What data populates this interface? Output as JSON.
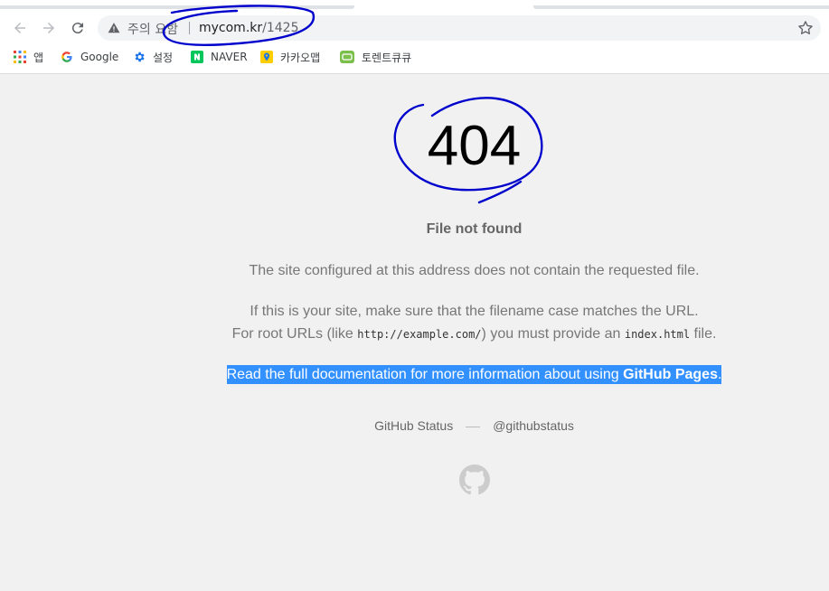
{
  "browser": {
    "back_icon": "arrow-left-icon",
    "forward_icon": "arrow-right-icon",
    "reload_icon": "reload-icon",
    "security_label": "주의 요함",
    "url_domain": "mycom.kr",
    "url_path": "/1425",
    "bookmarks": [
      {
        "label": "앱",
        "icon": "apps-grid-icon"
      },
      {
        "label": "Google",
        "icon": "google-g-icon"
      },
      {
        "label": "설정",
        "icon": "gear-icon"
      },
      {
        "label": "NAVER",
        "icon": "naver-n-icon"
      },
      {
        "label": "카카오맵",
        "icon": "map-pin-icon"
      },
      {
        "label": "토렌트큐큐",
        "icon": "torrent-icon"
      }
    ]
  },
  "page": {
    "code": "404",
    "title": "File not found",
    "p1": "The site configured at this address does not contain the requested file.",
    "p2_line1": "If this is your site, make sure that the filename case matches the URL.",
    "p2_prefix": "For root URLs (like ",
    "p2_code1": "http://example.com/",
    "p2_mid": ") you must provide an ",
    "p2_code2": "index.html",
    "p2_suffix": " file.",
    "doc_link": "Read the full documentation",
    "doc_text": " for more information about using ",
    "gh_pages_link": "GitHub Pages",
    "doc_end": ".",
    "status_link": "GitHub Status",
    "twitter_link": "@githubstatus"
  },
  "colors": {
    "selection": "#3390ff",
    "annotation": "#0000cc"
  }
}
